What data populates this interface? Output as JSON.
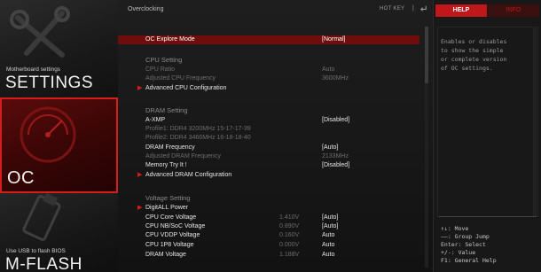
{
  "nav": {
    "settings": {
      "subtitle": "Motherboard settings",
      "title": "SETTINGS"
    },
    "oc": {
      "title": "OC"
    },
    "mflash": {
      "subtitle": "Use USB to flash BIOS",
      "title": "M-FLASH"
    }
  },
  "main": {
    "title": "Overclocking",
    "hotkey": "HOT KEY",
    "hotkey_sep": "|",
    "rows": [
      {
        "label": "OC Explore Mode",
        "value": "[Normal]",
        "style": "sel"
      },
      {
        "label": "CPU Setting",
        "style": "section"
      },
      {
        "label": "CPU Ratio",
        "value": "Auto",
        "style": "grey"
      },
      {
        "label": "Adjusted CPU Frequency",
        "value": "3600MHz",
        "style": "grey"
      },
      {
        "label": "Advanced CPU Configuration",
        "arrow": "▶",
        "style": "normal"
      },
      {
        "label": "DRAM Setting",
        "style": "section"
      },
      {
        "label": "A-XMP",
        "value": "[Disabled]",
        "style": "normal"
      },
      {
        "label": "Profile1: DDR4 3200MHz 15-17-17-39",
        "style": "grey"
      },
      {
        "label": "Profile2: DDR4 3466MHz 16-18-18-40",
        "style": "grey"
      },
      {
        "label": "DRAM Frequency",
        "value": "[Auto]",
        "style": "normal"
      },
      {
        "label": "Adjusted DRAM Frequency",
        "value": "2133MHz",
        "style": "grey"
      },
      {
        "label": "Memory Try It !",
        "value": "[Disabled]",
        "style": "normal"
      },
      {
        "label": "Advanced DRAM Configuration",
        "arrow": "▶",
        "style": "normal"
      },
      {
        "label": "Voltage Setting",
        "style": "section"
      },
      {
        "label": "DigitALL Power",
        "arrow": "▶",
        "style": "normal"
      },
      {
        "label": "CPU Core Voltage",
        "current": "1.410V",
        "value": "[Auto]",
        "style": "normal"
      },
      {
        "label": "CPU NB/SoC Voltage",
        "current": "0.890V",
        "value": "[Auto]",
        "style": "normal"
      },
      {
        "label": "CPU VDDP Voltage",
        "current": "0.160V",
        "value": "Auto",
        "style": "normal"
      },
      {
        "label": "CPU 1P8 Voltage",
        "current": "0.000V",
        "value": "Auto",
        "style": "normal"
      },
      {
        "label": "DRAM Voltage",
        "current": "1.188V",
        "value": "Auto",
        "style": "normal"
      }
    ]
  },
  "help": {
    "tab_help": "HELP",
    "tab_info": "INFO",
    "text_lines": [
      "Enables or disables",
      "to show the simple",
      "or complete version",
      "of OC settings."
    ],
    "hints": [
      "↑↓: Move",
      "——: Group Jump",
      "Enter: Select",
      "+/-: Value",
      "F1: General Help"
    ]
  },
  "colors": {
    "accent": "#d41d1d",
    "selected_row": "#6f0c0c",
    "background": "#0d0d0d"
  }
}
